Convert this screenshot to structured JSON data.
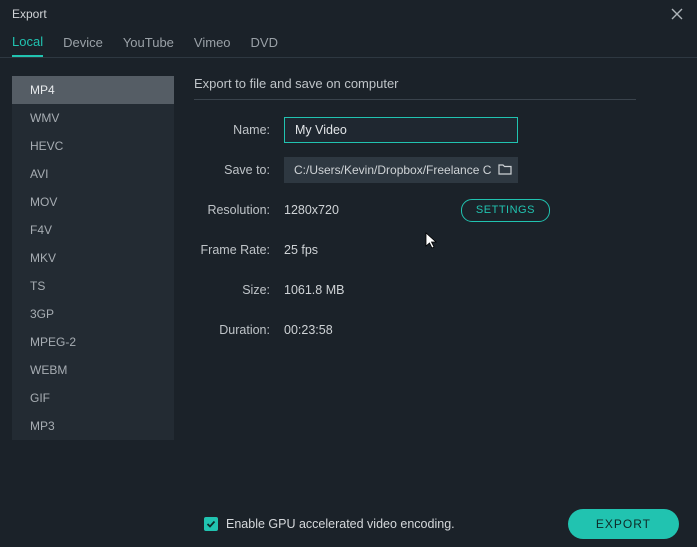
{
  "window": {
    "title": "Export"
  },
  "tabs": {
    "items": [
      "Local",
      "Device",
      "YouTube",
      "Vimeo",
      "DVD"
    ],
    "active_index": 0
  },
  "formats": {
    "items": [
      "MP4",
      "WMV",
      "HEVC",
      "AVI",
      "MOV",
      "F4V",
      "MKV",
      "TS",
      "3GP",
      "MPEG-2",
      "WEBM",
      "GIF",
      "MP3"
    ],
    "selected_index": 0
  },
  "section": {
    "heading": "Export to file and save on computer",
    "labels": {
      "name": "Name:",
      "save_to": "Save to:",
      "resolution": "Resolution:",
      "frame_rate": "Frame Rate:",
      "size": "Size:",
      "duration": "Duration:"
    },
    "values": {
      "name": "My Video",
      "save_to": "C:/Users/Kevin/Dropbox/Freelance Clients",
      "resolution": "1280x720",
      "frame_rate": "25 fps",
      "size": "1061.8 MB",
      "duration": "00:23:58"
    },
    "settings_button": "SETTINGS"
  },
  "footer": {
    "gpu_label": "Enable GPU accelerated video encoding.",
    "gpu_checked": true,
    "export_button": "EXPORT"
  }
}
